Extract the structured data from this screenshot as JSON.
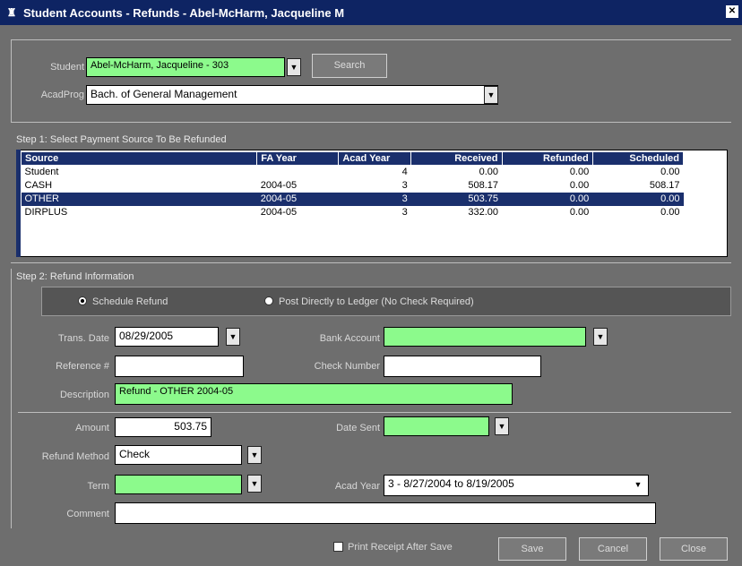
{
  "window": {
    "title": "Student Accounts - Refunds - Abel-McHarm, Jacqueline M"
  },
  "student": {
    "label": "Student",
    "value": "Abel-McHarm, Jacqueline - 303",
    "search_label": "Search"
  },
  "program": {
    "label": "AcadProg",
    "value": "Bach. of General Management"
  },
  "step1": {
    "title": "Step 1: Select Payment Source To Be Refunded",
    "columns": [
      "Source",
      "FA Year",
      "Acad Year",
      "Received",
      "Refunded",
      "Scheduled"
    ],
    "rows": [
      [
        "Student",
        "",
        "4",
        "0.00",
        "0.00",
        "0.00"
      ],
      [
        "CASH",
        "2004-05",
        "3",
        "508.17",
        "0.00",
        "508.17"
      ],
      [
        "OTHER",
        "2004-05",
        "3",
        "503.75",
        "0.00",
        "0.00"
      ],
      [
        "DIRPLUS",
        "2004-05",
        "3",
        "332.00",
        "0.00",
        "0.00"
      ]
    ],
    "selected_row": 2
  },
  "step2": {
    "title": "Step 2: Refund Information",
    "radio_schedule": "Schedule Refund",
    "radio_post": "Post Directly to Ledger (No Check Required)",
    "trans_date_label": "Trans. Date",
    "trans_date_value": "08/29/2005",
    "bank_account_label": "Bank Account",
    "bank_account_value": "",
    "reference_label": "Reference #",
    "reference_value": "",
    "check_number_label": "Check Number",
    "check_number_value": "",
    "description_label": "Description",
    "description_value": "Refund - OTHER 2004-05",
    "amount_label": "Amount",
    "amount_value": "503.75",
    "date_sent_label": "Date Sent",
    "date_sent_value": "",
    "refund_method_label": "Refund Method",
    "refund_method_value": "Check",
    "term_label": "Term",
    "term_value": "",
    "acad_year_label": "Acad Year",
    "acad_year_value": "3 - 8/27/2004 to 8/19/2005",
    "comment_label": "Comment",
    "comment_value": ""
  },
  "footer": {
    "print_receipt_label": "Print Receipt After Save",
    "save_label": "Save",
    "cancel_label": "Cancel",
    "close_label": "Close"
  },
  "colors": {
    "titlebar": "#0e2463",
    "required": "#8cfa8c",
    "selection": "#1a2f6c"
  }
}
